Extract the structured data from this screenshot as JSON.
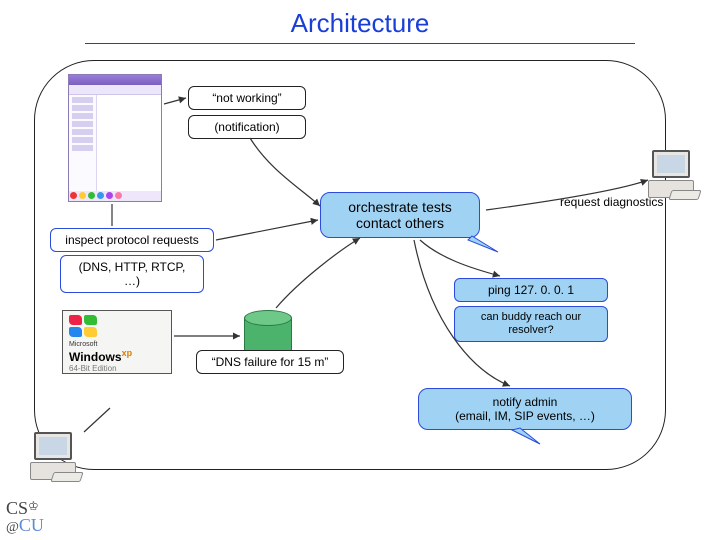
{
  "title": "Architecture",
  "boxes": {
    "not_working": "“not working”",
    "notification": "(notification)",
    "inspect1": "inspect protocol requests",
    "inspect2": "(DNS, HTTP, RTCP, …)",
    "orchestrate1": "orchestrate tests",
    "orchestrate2": "contact others",
    "dns_failure": "“DNS failure for 15 m”",
    "ping": "ping 127. 0. 0. 1",
    "buddy": "can buddy reach our resolver?",
    "notify": "notify admin\n(email, IM, SIP events, …)",
    "request_diag": "request diagnostics"
  },
  "winlogo": {
    "brand_prefix": "Microsoft",
    "brand": "Windows",
    "xp": "xp",
    "edition": "64-Bit Edition"
  },
  "footer": {
    "cs": "CS",
    "at": "@",
    "cu": "CU"
  }
}
